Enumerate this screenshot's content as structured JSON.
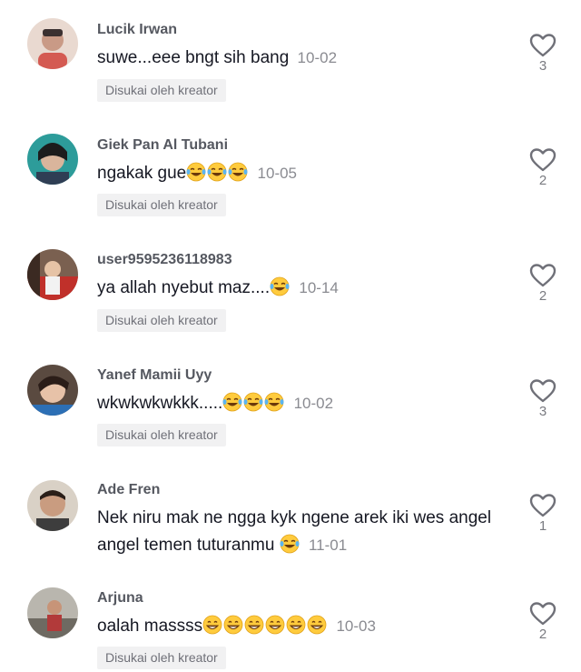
{
  "comments": [
    {
      "user": "Lucik Irwan",
      "text": "suwe...eee bngt sih bang",
      "emoji": [],
      "date": "10-02",
      "badge": "Disukai oleh kreator",
      "likes": "3"
    },
    {
      "user": "Giek Pan Al Tubani",
      "text": "ngakak gue",
      "emoji": [
        "face-with-tears-of-joy-icon",
        "face-with-tears-of-joy-icon",
        "face-with-tears-of-joy-icon"
      ],
      "date": "10-05",
      "badge": "Disukai oleh kreator",
      "likes": "2"
    },
    {
      "user": "user9595236118983",
      "text": "ya allah nyebut maz....",
      "emoji": [
        "face-with-tears-of-joy-icon"
      ],
      "date": "10-14",
      "badge": "Disukai oleh kreator",
      "likes": "2"
    },
    {
      "user": "Yanef Mamii Uyy",
      "text": "wkwkwkwkkk.....",
      "emoji": [
        "face-with-tears-of-joy-icon",
        "face-with-tears-of-joy-icon",
        "face-with-tears-of-joy-icon"
      ],
      "date": "10-02",
      "badge": "Disukai oleh kreator",
      "likes": "3"
    },
    {
      "user": "Ade Fren",
      "text": "Nek niru mak ne ngga kyk ngene arek iki wes angel angel temen tuturanmu",
      "emoji": [
        "face-with-tears-of-joy-icon"
      ],
      "date": "11-01",
      "badge": "",
      "likes": "1"
    },
    {
      "user": "Arjuna",
      "text": "oalah massss",
      "emoji": [
        "grinning-face-icon",
        "grinning-face-icon",
        "grinning-face-icon",
        "grinning-face-icon",
        "grinning-face-icon",
        "grinning-face-icon"
      ],
      "date": "10-03",
      "badge": "Disukai oleh kreator",
      "likes": "2"
    }
  ],
  "colors": {
    "text": "#161823",
    "username": "#555860",
    "date": "#8a8b91",
    "badge_bg": "#f1f1f2"
  }
}
